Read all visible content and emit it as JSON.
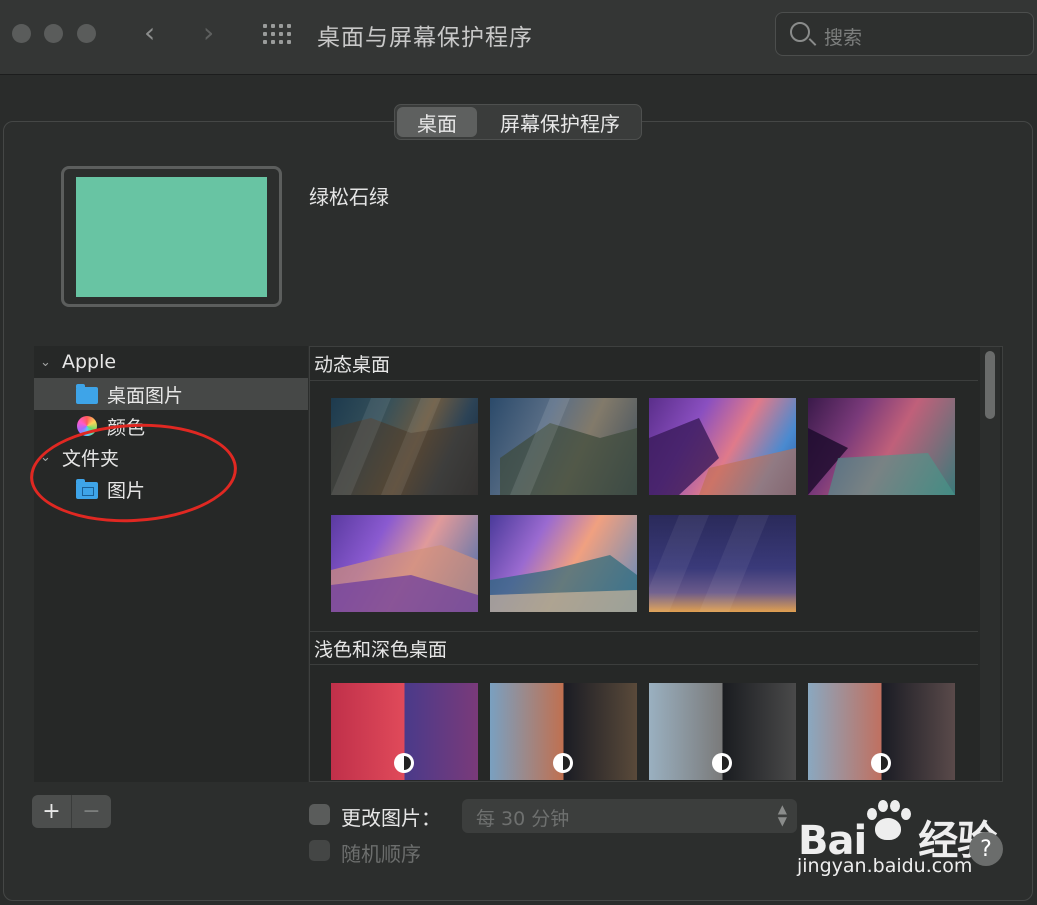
{
  "window": {
    "title": "桌面与屏幕保护程序",
    "back_glyph": "‹",
    "forward_glyph": "›"
  },
  "search": {
    "placeholder": "搜索"
  },
  "tabs": [
    {
      "label": "桌面",
      "active": true
    },
    {
      "label": "屏幕保护程序",
      "active": false
    }
  ],
  "preview": {
    "color": "#68c4a3",
    "name": "绿松石绿"
  },
  "sidebar": {
    "groups": [
      {
        "label": "Apple",
        "expanded": true,
        "items": [
          {
            "label": "桌面图片",
            "icon": "folder-icon",
            "selected": true
          },
          {
            "label": "颜色",
            "icon": "color-wheel-icon",
            "selected": false
          }
        ]
      },
      {
        "label": "文件夹",
        "expanded": true,
        "items": [
          {
            "label": "图片",
            "icon": "pictures-folder-icon",
            "selected": false
          }
        ]
      }
    ],
    "add_label": "+",
    "remove_label": "−"
  },
  "gallery": {
    "sections": [
      {
        "title": "动态桌面",
        "thumbnails": [
          "catalina-coast-dynamic",
          "catalina-island-dynamic",
          "purple-cliff-road-dynamic",
          "purple-lake-cliffs-dynamic",
          "desert-dunes-dynamic",
          "beach-cliffs-dynamic",
          "gradient-sky-dynamic"
        ]
      },
      {
        "title": "浅色和深色桌面",
        "thumbnails": [
          "big-sur-red-light-dark",
          "rock-formation-1-light-dark",
          "rock-formation-2-light-dark",
          "rock-formation-3-light-dark"
        ]
      }
    ]
  },
  "controls": {
    "change_picture_label": "更改图片：",
    "interval_value": "每 30 分钟",
    "random_order_label": "随机顺序"
  },
  "watermark": {
    "brand_left": "Bai",
    "brand_right": "经验",
    "domain": "jingyan.baidu.com"
  },
  "help": {
    "label": "?"
  },
  "colors": {
    "accent_folder": "#3ea4e8",
    "annotation_red": "#e02822"
  }
}
